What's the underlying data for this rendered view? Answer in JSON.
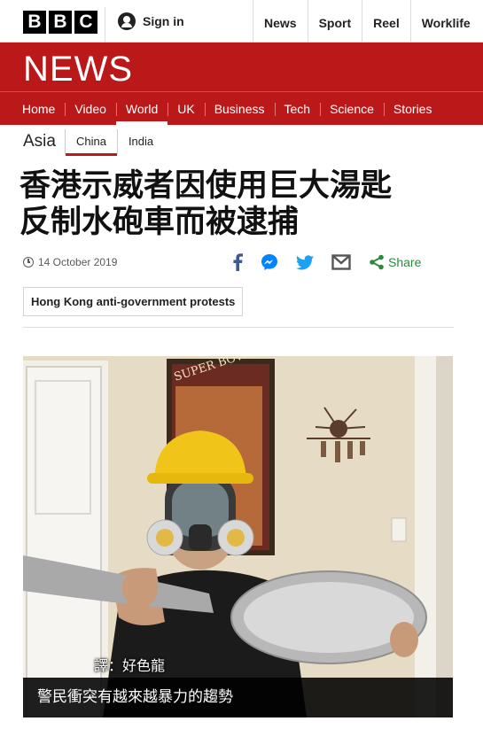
{
  "brand": {
    "letters": [
      "B",
      "B",
      "C"
    ],
    "news_wordmark": "NEWS",
    "brand_color": "#bb1919"
  },
  "topbar": {
    "signin_label": "Sign in",
    "nav": [
      "News",
      "Sport",
      "Reel",
      "Worklife"
    ]
  },
  "section_nav": {
    "items": [
      "Home",
      "Video",
      "World",
      "UK",
      "Business",
      "Tech",
      "Science",
      "Stories"
    ],
    "active": "World"
  },
  "sub_nav": {
    "region": "Asia",
    "items": [
      "China",
      "India"
    ],
    "active": "China"
  },
  "article": {
    "headline_line1": "香港示威者因使用巨大湯匙",
    "headline_line2": "反制水砲車而被逮捕",
    "date": "14 October 2019",
    "share_label": "Share",
    "share_icons": [
      "facebook-icon",
      "messenger-icon",
      "twitter-icon",
      "email-icon",
      "share-icon"
    ],
    "tag": "Hong Kong anti-government protests"
  },
  "photo": {
    "translator_credit": "譯：好色龍",
    "caption": "警民衝突有越來越暴力的趨勢",
    "poster_text": "SUPER BOWL XI"
  }
}
